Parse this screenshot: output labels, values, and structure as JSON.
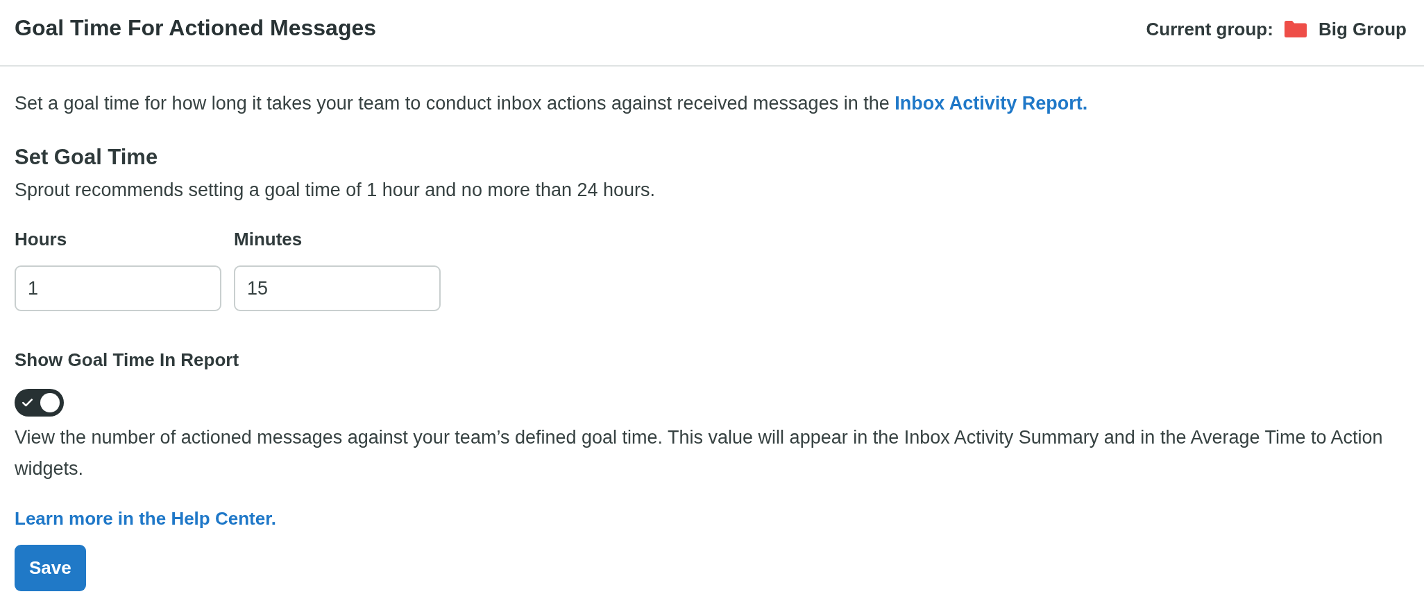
{
  "header": {
    "title": "Goal Time For Actioned Messages",
    "group_label": "Current group:",
    "group": {
      "name": "Big Group",
      "color": "#ee4e48"
    }
  },
  "intro": {
    "text": "Set a goal time for how long it takes your team to conduct inbox actions against received messages in the",
    "link": "Inbox Activity Report."
  },
  "goal_section": {
    "title": "Set Goal Time",
    "hint": "Sprout recommends setting a goal time of 1 hour and no more than 24 hours.",
    "fields": [
      {
        "label": "Hours",
        "value": "1"
      },
      {
        "label": "Minutes",
        "value": "15"
      }
    ]
  },
  "report_setting": {
    "label": "Show Goal Time In Report",
    "on": true,
    "description": "View the number of actioned messages against your team’s defined goal time. This value will appear in the Inbox Activity Summary and in the Average Time to Action widgets."
  },
  "help_link": "Learn more in the Help Center.",
  "buttons": [
    {
      "label": "Save"
    }
  ]
}
